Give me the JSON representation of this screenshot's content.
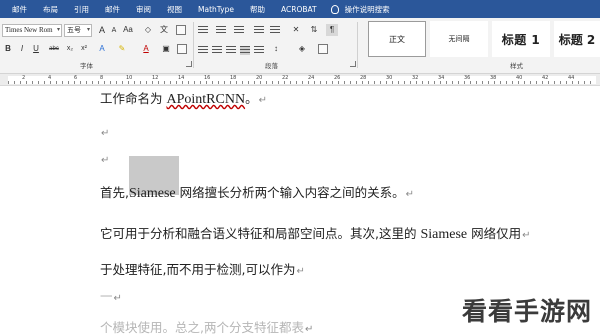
{
  "menu": {
    "items": [
      "邮件",
      "布局",
      "引用",
      "邮件",
      "审阅",
      "视图",
      "MathType",
      "帮助",
      "ACROBAT"
    ],
    "tell_me": "操作说明搜索"
  },
  "ribbon": {
    "font_name": "Times New Rom",
    "font_size": "五号",
    "group_font": "字体",
    "group_paragraph": "段落",
    "group_styles": "样式",
    "styles": [
      "正文",
      "无间隔",
      "标题 1",
      "标题 2"
    ],
    "format_buttons": [
      "B",
      "I",
      "U",
      "abc",
      "x₂",
      "x²",
      "A"
    ]
  },
  "ruler": {
    "numbers": [
      "2",
      "4",
      "6",
      "8",
      "10",
      "12",
      "14",
      "16",
      "18",
      "20",
      "22",
      "24",
      "26",
      "28",
      "30",
      "32",
      "34",
      "36",
      "38",
      "40",
      "42",
      "44"
    ]
  },
  "document": {
    "line1_pre": "工作命名为 ",
    "line1_latin": "APointRCNN",
    "line1_post": "。",
    "line4_pre": "首先,",
    "line4_latin": "Siamese",
    "line4_post": " 网络擅长分析两个输入内容之间的关系。",
    "line5_pre": "它可用于分析和融合语义特征和局部空间点。其次,这里的 ",
    "line5_latin": "Siamese",
    "line5_post": " 网络仅用",
    "line6": "于处理特征,而不用于检测,可以作为",
    "line7": "一",
    "line8": "个模块使用。总之,两个分支特征都表",
    "para_mark": "↵"
  },
  "watermark": "看看手游网"
}
